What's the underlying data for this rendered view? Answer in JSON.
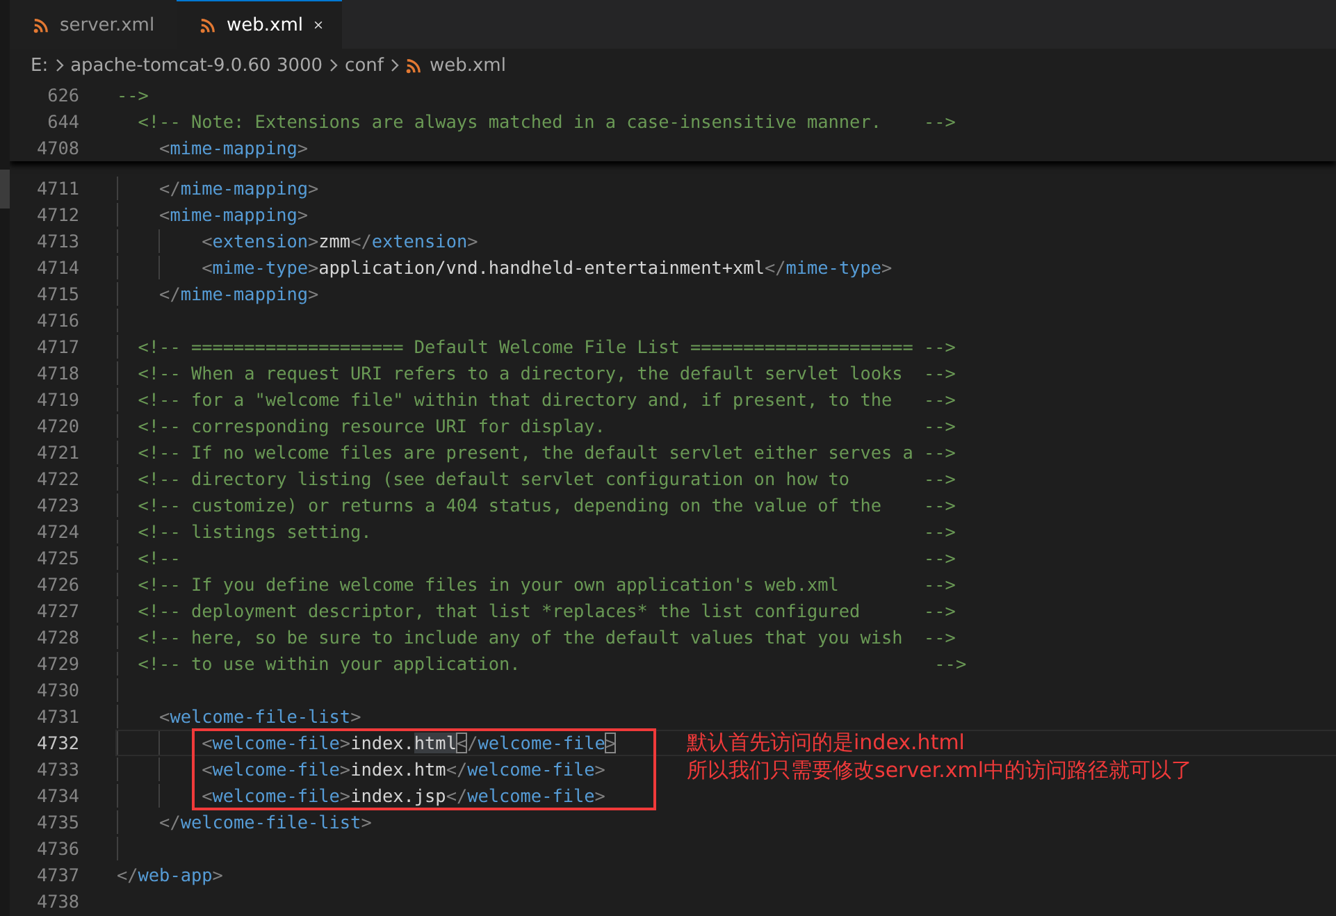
{
  "tabs": [
    {
      "label": "server.xml",
      "selected": false,
      "closable": false
    },
    {
      "label": "web.xml",
      "selected": true,
      "closable": true
    }
  ],
  "breadcrumb": [
    {
      "label": "E:",
      "icon": false
    },
    {
      "label": "apache-tomcat-9.0.60 3000",
      "icon": false
    },
    {
      "label": "conf",
      "icon": false
    },
    {
      "label": "web.xml",
      "icon": true
    }
  ],
  "sticky_lines": [
    {
      "number": "626",
      "tokens": [
        {
          "kind": "comment",
          "text": "-->"
        }
      ]
    },
    {
      "number": "644",
      "tokens": [
        {
          "kind": "comment",
          "text": "  <!-- Note: Extensions are always matched in a case-insensitive manner.    -->"
        }
      ]
    },
    {
      "number": "4708",
      "tokens": [
        {
          "kind": "bracket",
          "text": "    <"
        },
        {
          "kind": "tag",
          "text": "mime-mapping"
        },
        {
          "kind": "bracket",
          "text": ">"
        }
      ]
    }
  ],
  "lines": [
    {
      "number": "4711",
      "current": false,
      "boxed": false,
      "tokens": [
        {
          "kind": "bracket",
          "text": "    </"
        },
        {
          "kind": "tag",
          "text": "mime-mapping"
        },
        {
          "kind": "bracket",
          "text": ">"
        }
      ]
    },
    {
      "number": "4712",
      "current": false,
      "boxed": false,
      "tokens": [
        {
          "kind": "bracket",
          "text": "    <"
        },
        {
          "kind": "tag",
          "text": "mime-mapping"
        },
        {
          "kind": "bracket",
          "text": ">"
        }
      ]
    },
    {
      "number": "4713",
      "current": false,
      "boxed": false,
      "tokens": [
        {
          "kind": "bracket",
          "text": "        <"
        },
        {
          "kind": "tag",
          "text": "extension"
        },
        {
          "kind": "bracket",
          "text": ">"
        },
        {
          "kind": "text",
          "text": "zmm"
        },
        {
          "kind": "bracket",
          "text": "</"
        },
        {
          "kind": "tag",
          "text": "extension"
        },
        {
          "kind": "bracket",
          "text": ">"
        }
      ]
    },
    {
      "number": "4714",
      "current": false,
      "boxed": false,
      "tokens": [
        {
          "kind": "bracket",
          "text": "        <"
        },
        {
          "kind": "tag",
          "text": "mime-type"
        },
        {
          "kind": "bracket",
          "text": ">"
        },
        {
          "kind": "text",
          "text": "application/vnd.handheld-entertainment+xml"
        },
        {
          "kind": "bracket",
          "text": "</"
        },
        {
          "kind": "tag",
          "text": "mime-type"
        },
        {
          "kind": "bracket",
          "text": ">"
        }
      ]
    },
    {
      "number": "4715",
      "current": false,
      "boxed": false,
      "tokens": [
        {
          "kind": "bracket",
          "text": "    </"
        },
        {
          "kind": "tag",
          "text": "mime-mapping"
        },
        {
          "kind": "bracket",
          "text": ">"
        }
      ]
    },
    {
      "number": "4716",
      "current": false,
      "boxed": false
    },
    {
      "number": "4717",
      "current": false,
      "boxed": false,
      "tokens": [
        {
          "kind": "comment",
          "text": "  <!-- ==================== Default Welcome File List ===================== -->"
        }
      ]
    },
    {
      "number": "4718",
      "current": false,
      "boxed": false,
      "tokens": [
        {
          "kind": "comment",
          "text": "  <!-- When a request URI refers to a directory, the default servlet looks  -->"
        }
      ]
    },
    {
      "number": "4719",
      "current": false,
      "boxed": false,
      "tokens": [
        {
          "kind": "comment",
          "text": "  <!-- for a \"welcome file\" within that directory and, if present, to the   -->"
        }
      ]
    },
    {
      "number": "4720",
      "current": false,
      "boxed": false,
      "tokens": [
        {
          "kind": "comment",
          "text": "  <!-- corresponding resource URI for display.                              -->"
        }
      ]
    },
    {
      "number": "4721",
      "current": false,
      "boxed": false,
      "tokens": [
        {
          "kind": "comment",
          "text": "  <!-- If no welcome files are present, the default servlet either serves a -->"
        }
      ]
    },
    {
      "number": "4722",
      "current": false,
      "boxed": false,
      "tokens": [
        {
          "kind": "comment",
          "text": "  <!-- directory listing (see default servlet configuration on how to       -->"
        }
      ]
    },
    {
      "number": "4723",
      "current": false,
      "boxed": false,
      "tokens": [
        {
          "kind": "comment",
          "text": "  <!-- customize) or returns a 404 status, depending on the value of the    -->"
        }
      ]
    },
    {
      "number": "4724",
      "current": false,
      "boxed": false,
      "tokens": [
        {
          "kind": "comment",
          "text": "  <!-- listings setting.                                                    -->"
        }
      ]
    },
    {
      "number": "4725",
      "current": false,
      "boxed": false,
      "tokens": [
        {
          "kind": "comment",
          "text": "  <!--                                                                      -->"
        }
      ]
    },
    {
      "number": "4726",
      "current": false,
      "boxed": false,
      "tokens": [
        {
          "kind": "comment",
          "text": "  <!-- If you define welcome files in your own application's web.xml        -->"
        }
      ]
    },
    {
      "number": "4727",
      "current": false,
      "boxed": false,
      "tokens": [
        {
          "kind": "comment",
          "text": "  <!-- deployment descriptor, that list *replaces* the list configured      -->"
        }
      ]
    },
    {
      "number": "4728",
      "current": false,
      "boxed": false,
      "tokens": [
        {
          "kind": "comment",
          "text": "  <!-- here, so be sure to include any of the default values that you wish  -->"
        }
      ]
    },
    {
      "number": "4729",
      "current": false,
      "boxed": false,
      "tokens": [
        {
          "kind": "comment",
          "text": "  <!-- to use within your application.                                       -->"
        }
      ]
    },
    {
      "number": "4730",
      "current": false,
      "boxed": false
    },
    {
      "number": "4731",
      "current": false,
      "boxed": false,
      "tokens": [
        {
          "kind": "bracket",
          "text": "    <"
        },
        {
          "kind": "tag",
          "text": "welcome-file-list"
        },
        {
          "kind": "bracket",
          "text": ">"
        }
      ]
    },
    {
      "number": "4732",
      "current": true,
      "boxed": true,
      "tokens": [
        {
          "kind": "bracket",
          "text": "        <"
        },
        {
          "kind": "tag",
          "text": "welcome-file"
        },
        {
          "kind": "bracket",
          "text": ">"
        },
        {
          "kind": "text",
          "text": "index."
        },
        {
          "kind": "highlight",
          "text": "html"
        },
        {
          "kind": "matched",
          "text": "<"
        },
        {
          "kind": "bracket",
          "text": "/"
        },
        {
          "kind": "tag",
          "text": "welcome-file"
        },
        {
          "kind": "matched",
          "text": ">"
        }
      ]
    },
    {
      "number": "4733",
      "current": false,
      "boxed": true,
      "tokens": [
        {
          "kind": "bracket",
          "text": "        <"
        },
        {
          "kind": "tag",
          "text": "welcome-file"
        },
        {
          "kind": "bracket",
          "text": ">"
        },
        {
          "kind": "text",
          "text": "index.htm"
        },
        {
          "kind": "bracket",
          "text": "</"
        },
        {
          "kind": "tag",
          "text": "welcome-file"
        },
        {
          "kind": "bracket",
          "text": ">"
        }
      ]
    },
    {
      "number": "4734",
      "current": false,
      "boxed": true,
      "tokens": [
        {
          "kind": "bracket",
          "text": "        <"
        },
        {
          "kind": "tag",
          "text": "welcome-file"
        },
        {
          "kind": "bracket",
          "text": ">"
        },
        {
          "kind": "text",
          "text": "index.jsp"
        },
        {
          "kind": "bracket",
          "text": "</"
        },
        {
          "kind": "tag",
          "text": "welcome-file"
        },
        {
          "kind": "bracket",
          "text": ">"
        }
      ]
    },
    {
      "number": "4735",
      "current": false,
      "boxed": false,
      "tokens": [
        {
          "kind": "bracket",
          "text": "    </"
        },
        {
          "kind": "tag",
          "text": "welcome-file-list"
        },
        {
          "kind": "bracket",
          "text": ">"
        }
      ]
    },
    {
      "number": "4736",
      "current": false,
      "boxed": false
    },
    {
      "number": "4737",
      "current": false,
      "boxed": false,
      "tokens": [
        {
          "kind": "bracket",
          "text": "</"
        },
        {
          "kind": "tag",
          "text": "web-app"
        },
        {
          "kind": "bracket",
          "text": ">"
        }
      ]
    },
    {
      "number": "4738",
      "current": false,
      "boxed": false
    }
  ],
  "annotation": {
    "lines": [
      "默认首先访问的是index.html",
      "所以我们只需要修改server.xml中的访问路径就可以了"
    ]
  }
}
